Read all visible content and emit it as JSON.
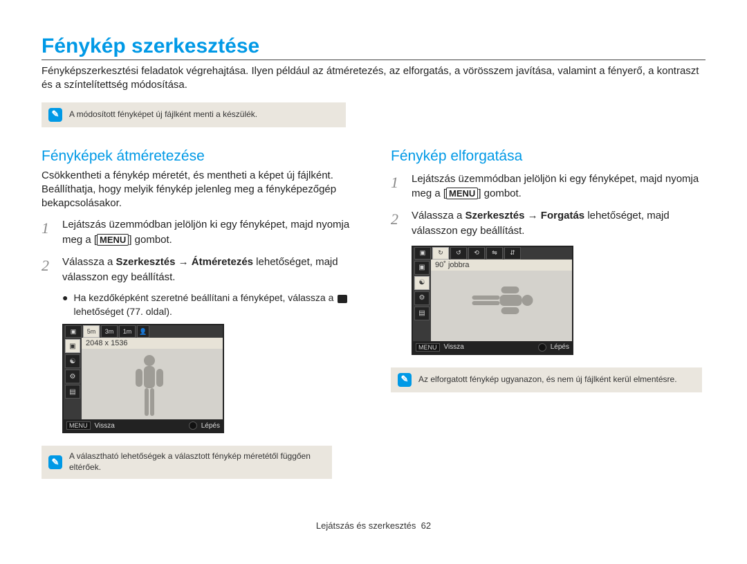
{
  "main_title": "Fénykép szerkesztése",
  "intro": "Fényképszerkesztési feladatok végrehajtása. Ilyen például az átméretezés, az elforgatás, a vörösszem javítása, valamint a fényerő, a kontraszt és a színtelítettség módosítása.",
  "note_top": "A módosított fényképet új fájlként menti a készülék.",
  "left": {
    "title": "Fényképek átméretezése",
    "desc": "Csökkentheti a fénykép méretét, és mentheti a képet új fájlként. Beállíthatja, hogy melyik fénykép jelenleg meg a fényképezőgép bekapcsolásakor.",
    "step1_a": "Lejátszás üzemmódban jelöljön ki egy fényképet, majd nyomja meg a [",
    "step1_menu": "MENU",
    "step1_b": "] gombot.",
    "step2_a": "Válassza a ",
    "step2_b1": "Szerkesztés",
    "step2_arrow": " → ",
    "step2_b2": "Átméretezés",
    "step2_c": " lehetőséget, majd válasszon egy beállítást.",
    "bullet1": "Ha kezdőképként szeretné beállítani a fényképet, válassza a",
    "bullet2": "lehetőséget (77. oldal).",
    "note": "A választható lehetőségek a választott fénykép méretétől függően eltérőek."
  },
  "right": {
    "title": "Fénykép elforgatása",
    "step1_a": "Lejátszás üzemmódban jelöljön ki egy fényképet, majd nyomja meg a [",
    "step1_menu": "MENU",
    "step1_b": "] gombot.",
    "step2_a": "Válassza a ",
    "step2_b1": "Szerkesztés",
    "step2_arrow": " → ",
    "step2_b2": "Forgatás",
    "step2_c": " lehetőséget, majd válasszon egy beállítást.",
    "note": "Az elforgatott fénykép ugyanazon, és nem új fájlként kerül elmentésre."
  },
  "cam1": {
    "size_5m": "5m",
    "size_3m": "3m",
    "size_1m": "1m",
    "value": "2048 x 1536",
    "menu": "MENU",
    "back": "Vissza",
    "move": "Lépés"
  },
  "cam2": {
    "value": "90˚ jobbra",
    "menu": "MENU",
    "back": "Vissza",
    "move": "Lépés"
  },
  "footer_text": "Lejátszás és szerkesztés",
  "page_num": "62"
}
